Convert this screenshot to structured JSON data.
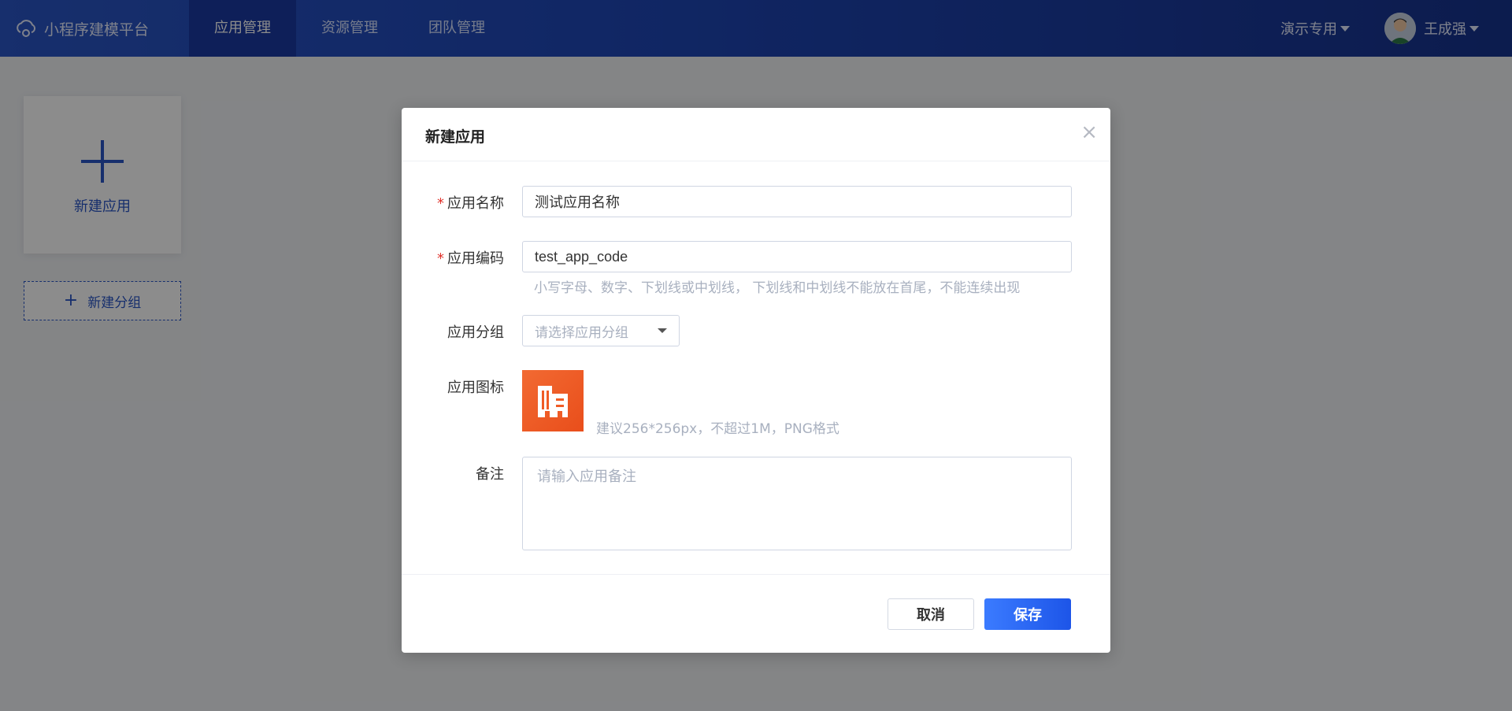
{
  "header": {
    "logo_text": "小程序建模平台",
    "nav": [
      {
        "label": "应用管理",
        "active": true
      },
      {
        "label": "资源管理",
        "active": false
      },
      {
        "label": "团队管理",
        "active": false
      }
    ],
    "org_label": "演示专用",
    "user_name": "王成强"
  },
  "page": {
    "new_app_label": "新建应用",
    "new_group_label": "新建分组"
  },
  "modal": {
    "title": "新建应用",
    "close_icon": "×",
    "fields": {
      "name": {
        "label": "应用名称",
        "value": "测试应用名称",
        "required": true
      },
      "code": {
        "label": "应用编码",
        "value": "test_app_code",
        "required": true,
        "hint": "小写字母、数字、下划线或中划线， 下划线和中划线不能放在首尾，不能连续出现"
      },
      "group": {
        "label": "应用分组",
        "placeholder": "请选择应用分组"
      },
      "icon": {
        "label": "应用图标",
        "hint": "建议256*256px，不超过1M，PNG格式"
      },
      "remark": {
        "label": "备注",
        "placeholder": "请输入应用备注"
      }
    },
    "cancel_label": "取消",
    "save_label": "保存"
  },
  "colors": {
    "primary": "#2a56c6",
    "header_dark": "#17338e",
    "icon_orange": "#f26a32",
    "required": "#e0322b"
  }
}
